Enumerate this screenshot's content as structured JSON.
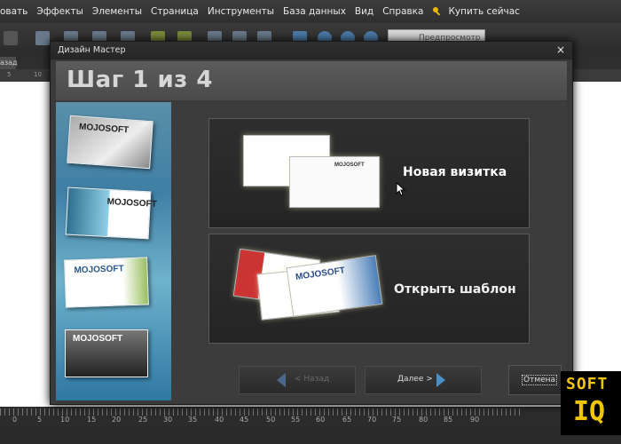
{
  "menu": {
    "items": [
      "овать",
      "Эффекты",
      "Элементы",
      "Страница",
      "Инструменты",
      "База данных",
      "Вид",
      "Справка"
    ],
    "buy": "Купить сейчас"
  },
  "toolbar": {
    "preview_label": "Предпросмотр"
  },
  "back_tab": "азад",
  "ruler_top": [
    "5",
    "10"
  ],
  "ruler_bottom": [
    "0",
    "5",
    "10",
    "15",
    "20",
    "25",
    "30",
    "35",
    "40",
    "45",
    "50",
    "55",
    "60",
    "65",
    "70",
    "75",
    "80",
    "85",
    "90"
  ],
  "dialog": {
    "title": "Дизайн Мастер",
    "close": "×",
    "step": "Шаг 1 из 4",
    "side_cards": [
      {
        "brand": "MOJOSOFT"
      },
      {
        "brand": "MOJOSOFT"
      },
      {
        "brand": "MOJOSOFT"
      },
      {
        "brand": "MOJOSOFT"
      }
    ],
    "option_new": {
      "label": "Новая визитка",
      "card_brand": "MOJOSOFT"
    },
    "option_open": {
      "label": "Открыть шаблон",
      "card_brand": "MOJOSOFT"
    },
    "back_button": "< Назад",
    "next_button": "Далее >",
    "cancel_button": "Отмена"
  },
  "watermark": {
    "line1": "SOFT",
    "line2": "IQ"
  },
  "colors": {
    "accent": "#f2c500",
    "arrow": "#4a8fc6"
  }
}
